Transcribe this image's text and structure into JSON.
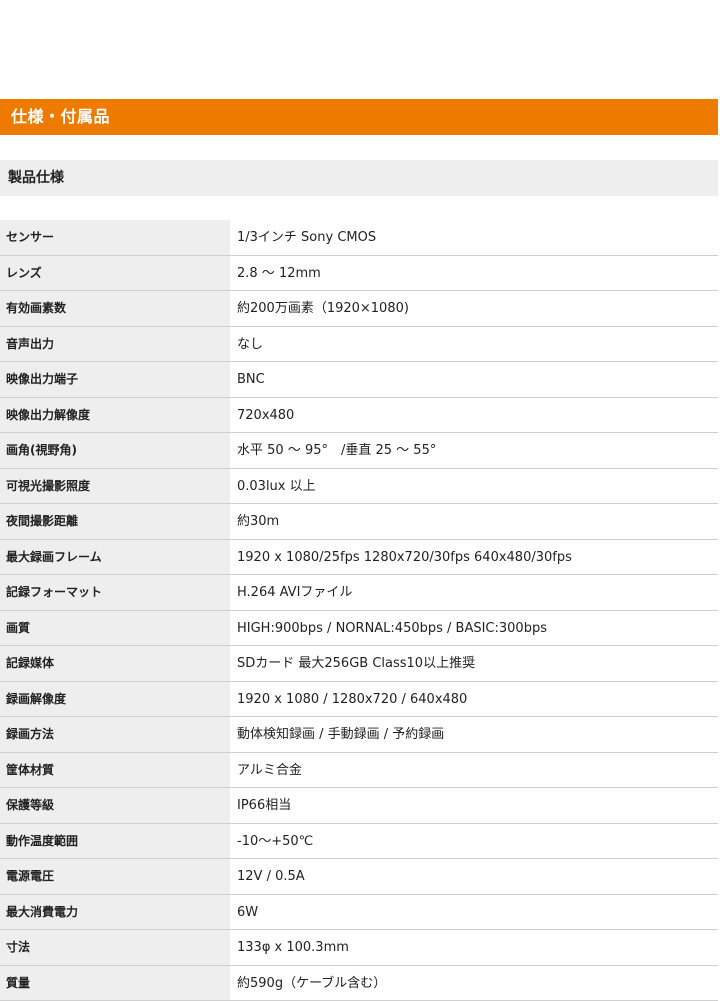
{
  "section": {
    "title": "仕様・付属品"
  },
  "subsection": {
    "title": "製品仕様"
  },
  "specs": [
    {
      "label": "センサー",
      "value": "1/3インチ Sony CMOS"
    },
    {
      "label": "レンズ",
      "value": "2.8 ～ 12mm"
    },
    {
      "label": "有効画素数",
      "value": "約200万画素（1920×1080)"
    },
    {
      "label": "音声出力",
      "value": "なし"
    },
    {
      "label": "映像出力端子",
      "value": "BNC"
    },
    {
      "label": "映像出力解像度",
      "value": "720x480"
    },
    {
      "label": "画角(視野角)",
      "value": "水平 50 ～ 95°　/垂直 25 ～ 55°"
    },
    {
      "label": "可視光撮影照度",
      "value": "0.03lux 以上"
    },
    {
      "label": "夜間撮影距離",
      "value": "約30m"
    },
    {
      "label": "最大録画フレーム",
      "value": "1920 x 1080/25fps 1280x720/30fps 640x480/30fps"
    },
    {
      "label": "記録フォーマット",
      "value": "H.264 AVIファイル"
    },
    {
      "label": "画質",
      "value": "HIGH:900bps / NORNAL:450bps / BASIC:300bps"
    },
    {
      "label": "記録媒体",
      "value": "SDカード 最大256GB Class10以上推奨"
    },
    {
      "label": "録画解像度",
      "value": "1920 x 1080 / 1280x720 / 640x480"
    },
    {
      "label": "録画方法",
      "value": "動体検知録画 / 手動録画 / 予約録画"
    },
    {
      "label": "筐体材質",
      "value": "アルミ合金"
    },
    {
      "label": "保護等級",
      "value": "IP66相当"
    },
    {
      "label": "動作温度範囲",
      "value": "-10～+50℃"
    },
    {
      "label": "電源電圧",
      "value": "12V / 0.5A"
    },
    {
      "label": "最大消費電力",
      "value": "6W"
    },
    {
      "label": "寸法",
      "value": "133φ x 100.3mm"
    },
    {
      "label": "質量",
      "value": "約590g（ケーブル含む）"
    }
  ]
}
